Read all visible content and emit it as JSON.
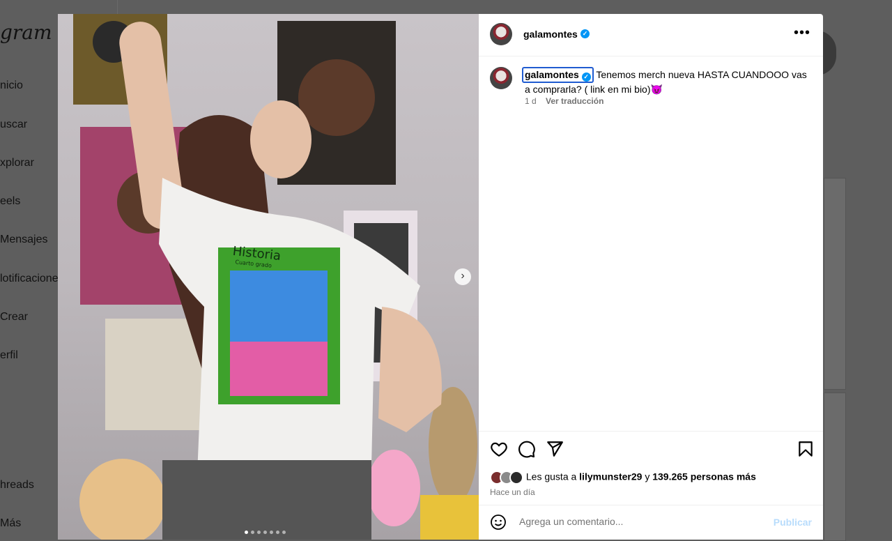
{
  "background": {
    "logo": "gram",
    "nav": [
      "nicio",
      "uscar",
      "xplorar",
      "eels",
      "Mensajes",
      "lotificacione",
      "Crear",
      "erfil",
      "hreads",
      "Más"
    ]
  },
  "post": {
    "username": "galamontes",
    "caption_text": " Tenemos merch nueva HASTA CUANDOOO vas a comprarla? ( link en mi bio)😈",
    "time": "1 d",
    "translate_label": "Ver traducción",
    "more_label": "•••",
    "image": {
      "shirt_title": "Historia",
      "shirt_subtitle": "Cuarto grado"
    },
    "carousel": {
      "count": 7,
      "active": 0
    },
    "likes_prefix": "Les gusta a ",
    "likes_user": "lilymunster29",
    "likes_mid": " y ",
    "likes_others": "139.265 personas más",
    "posted_ago": "Hace un día",
    "comment_placeholder": "Agrega un comentario...",
    "publish_label": "Publicar"
  },
  "colors": {
    "verified": "#0095f6",
    "publish_disabled": "#b8dcfc",
    "highlight_outline": "#1f5bd0"
  },
  "icons": [
    "heart-icon",
    "comment-icon",
    "share-icon",
    "bookmark-icon",
    "emoji-icon",
    "chevron-right-icon",
    "verified-icon",
    "more-icon"
  ]
}
